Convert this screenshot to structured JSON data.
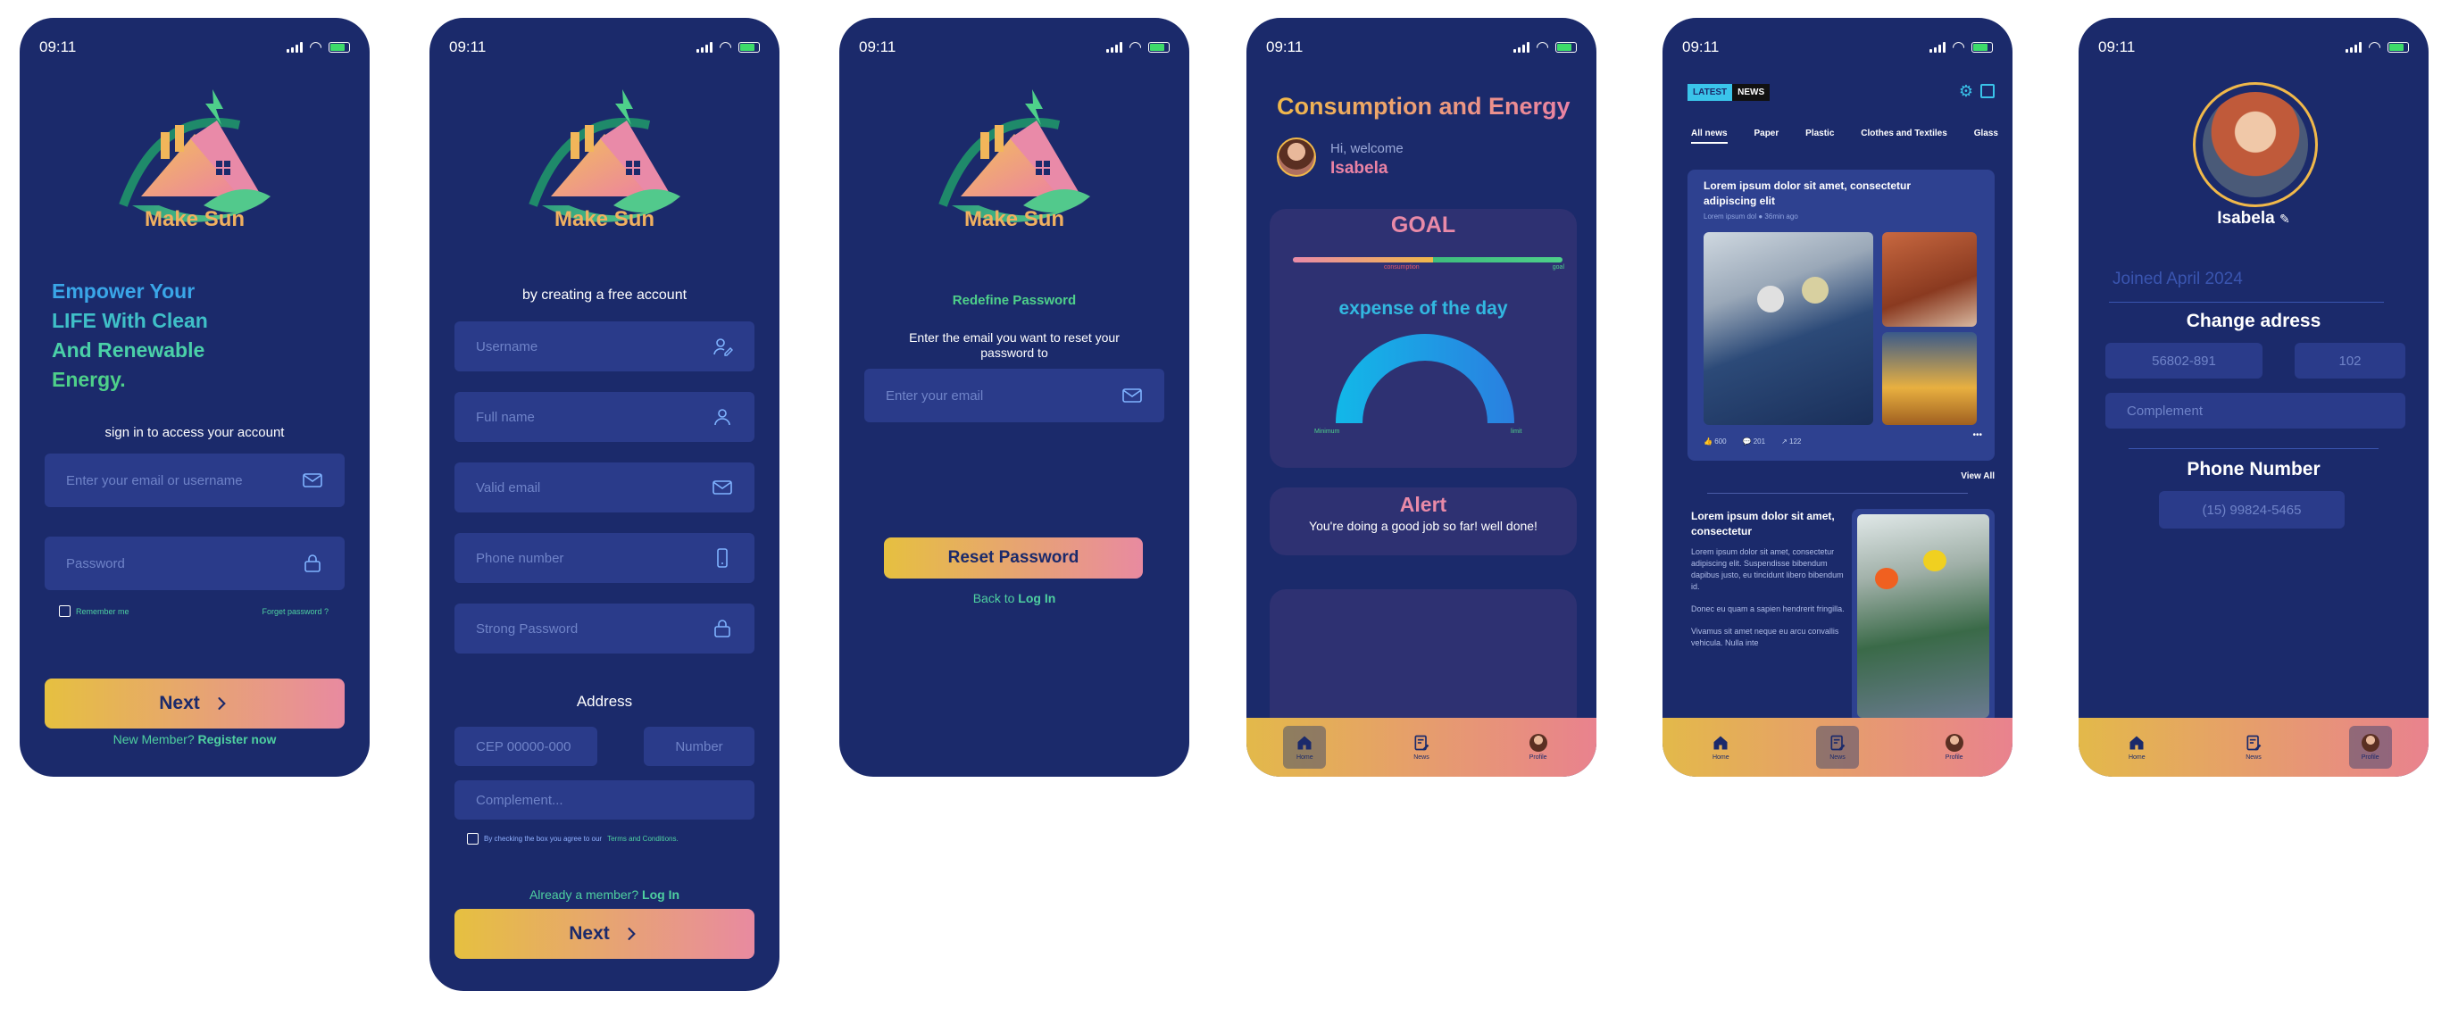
{
  "status_time": "09:11",
  "brand": "Make Sun",
  "login": {
    "tagline": [
      "Empower Your",
      "LIFE With Clean",
      "And Renewable",
      "Energy."
    ],
    "subtitle": "sign in to access your account",
    "email_placeholder": "Enter your email or username",
    "password_placeholder": "Password",
    "remember": "Remember me",
    "forgot": "Forget password ?",
    "next": "Next",
    "new_member": "New Member?",
    "register": "Register now"
  },
  "signup": {
    "subtitle": "by creating a free account",
    "fields": [
      "Username",
      "Full name",
      "Valid email",
      "Phone number",
      "Strong Password"
    ],
    "address_title": "Address",
    "cep_placeholder": "CEP 00000-000",
    "number_placeholder": "Number",
    "complement_placeholder": "Complement...",
    "terms_prefix": "By checking the box you agree to our",
    "terms_link": "Terms and Conditions.",
    "already": "Already a member?",
    "login": "Log In",
    "next": "Next"
  },
  "reset": {
    "title": "Redefine Password",
    "description": "Enter the email you want to reset your password to",
    "email_placeholder": "Enter your email",
    "button": "Reset Password",
    "back": "Back to",
    "login": "Log In"
  },
  "dashboard": {
    "title": "Consumption and Energy",
    "greeting": "Hi, welcome",
    "user": "Isabela",
    "goal_title": "GOAL",
    "goal_progress": 0.52,
    "consumption_label": "consumption",
    "goal_label": "goal",
    "expense_title": "expense of the day",
    "min_label": "Minimum",
    "limit_label": "limit",
    "alert_title": "Alert",
    "alert_text": "You're doing a good job so far! well done!"
  },
  "news": {
    "badge_latest": "LATEST",
    "badge_news": "NEWS",
    "tabs": [
      "All news",
      "Paper",
      "Plastic",
      "Clothes and Textiles",
      "Glass"
    ],
    "post_title": "Lorem ipsum dolor sit amet, consectetur adipiscing elit",
    "post_author": "Lorem ipsum dol",
    "post_time": "36min ago",
    "likes": "600",
    "comments": "201",
    "shares": "122",
    "view_all": "View All",
    "article_title": "Lorem ipsum dolor sit amet, consectetur",
    "article_p1": "Lorem ipsum dolor sit amet, consectetur adipiscing elit. Suspendisse bibendum dapibus justo, eu tincidunt libero bibendum id.",
    "article_p2": "Donec eu quam a sapien hendrerit fringilla.",
    "article_p3": "Vivamus sit amet neque eu arcu convallis vehicula. Nulla inte"
  },
  "profile": {
    "name": "Isabela",
    "joined": "Joined April 2024",
    "change_address": "Change adress",
    "cep": "56802-891",
    "number": "102",
    "complement_placeholder": "Complement",
    "phone_title": "Phone Number",
    "phone": "(15) 99824-5465"
  },
  "nav": [
    "Home",
    "News",
    "Profile"
  ],
  "colors": {
    "bg": "#1b2a6b",
    "field": "#2a3b8a",
    "accent_green": "#4ed0a0",
    "accent_pink": "#e98aa8",
    "gold": "#f0b060"
  }
}
